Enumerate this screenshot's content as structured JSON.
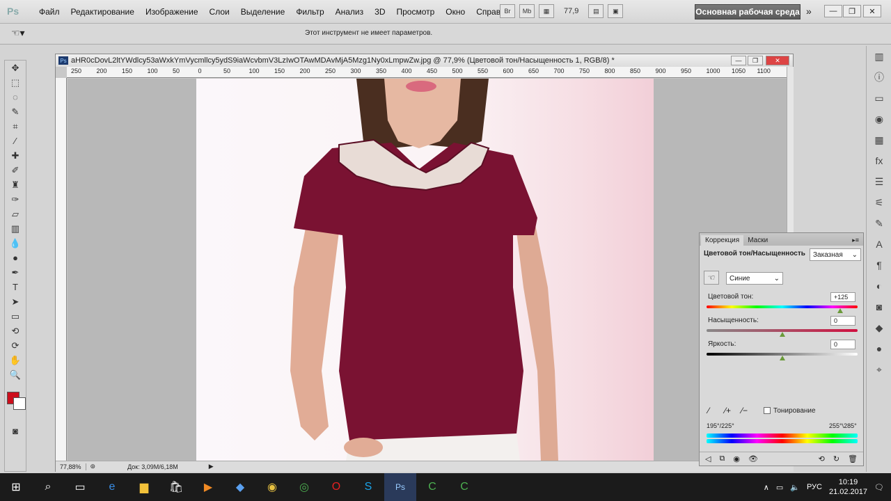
{
  "app": {
    "logo": "Ps",
    "menu": [
      "Файл",
      "Редактирование",
      "Изображение",
      "Слои",
      "Выделение",
      "Фильтр",
      "Анализ",
      "3D",
      "Просмотр",
      "Окно",
      "Справка"
    ],
    "zoom": "77,9",
    "workspace": "Основная рабочая среда"
  },
  "options_bar": {
    "message": "Этот инструмент не имеет параметров."
  },
  "document": {
    "title": "aHR0cDovL2ltYWdlcy53aWxkYmVycmllcy5ydS9iaWcvbmV3LzIwOTAwMDAvMjA5Mzg1Ny0xLmpwZw.jpg @ 77,9% (Цветовой тон/Насыщенность 1, RGB/8) *",
    "ruler_labels": [
      "250",
      "200",
      "150",
      "100",
      "50",
      "0",
      "50",
      "100",
      "150",
      "200",
      "250",
      "300",
      "350",
      "400",
      "450",
      "500",
      "550",
      "600",
      "650",
      "700",
      "750",
      "800",
      "850",
      "900",
      "950",
      "1000",
      "1050",
      "1100"
    ],
    "status_zoom": "77,88%",
    "status_doc": "Док: 3,09M/6,18M"
  },
  "panel": {
    "tabs": [
      "Коррекция",
      "Маски"
    ],
    "heading": "Цветовой тон/Насыщенность",
    "preset": "Заказная",
    "channel": "Синие",
    "hue_label": "Цветовой тон:",
    "hue_value": "+125",
    "sat_label": "Насыщенность:",
    "sat_value": "0",
    "light_label": "Яркость:",
    "light_value": "0",
    "colorize_label": "Тонирование",
    "range_left": "195°/225°",
    "range_right": "255°\\285°"
  },
  "taskbar": {
    "lang": "РУС",
    "time": "10:19",
    "date": "21.02.2017"
  }
}
